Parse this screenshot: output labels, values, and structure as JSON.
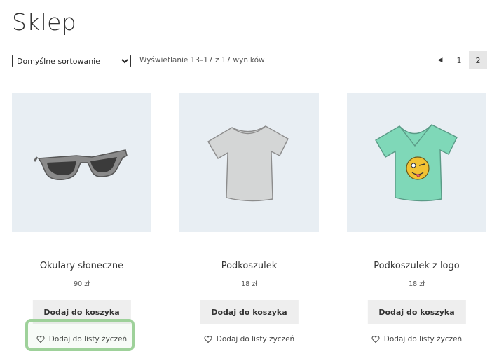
{
  "page": {
    "title": "Sklep"
  },
  "toolbar": {
    "sort_selected": "Domyślne sortowanie",
    "result_count": "Wyświetlanie 13–17 z 17 wyników"
  },
  "pagination": {
    "prev_icon": "caret-left-icon",
    "pages": [
      "1",
      "2"
    ],
    "current": "2"
  },
  "products": [
    {
      "title": "Okulary słoneczne",
      "price": "90 zł",
      "cart_label": "Dodaj do koszyka",
      "wishlist_label": "Dodaj do listy życzeń",
      "image": "sunglasses"
    },
    {
      "title": "Podkoszulek",
      "price": "18 zł",
      "cart_label": "Dodaj do koszyka",
      "wishlist_label": "Dodaj do listy życzeń",
      "image": "grey-tshirt"
    },
    {
      "title": "Podkoszulek z logo",
      "price": "18 zł",
      "cart_label": "Dodaj do koszyka",
      "wishlist_label": "Dodaj do listy życzeń",
      "image": "teal-tshirt-with-logo"
    }
  ],
  "colors": {
    "image_bg": "#e8eef3",
    "button_bg": "#eeeeee",
    "highlight": "#9ed19a"
  }
}
